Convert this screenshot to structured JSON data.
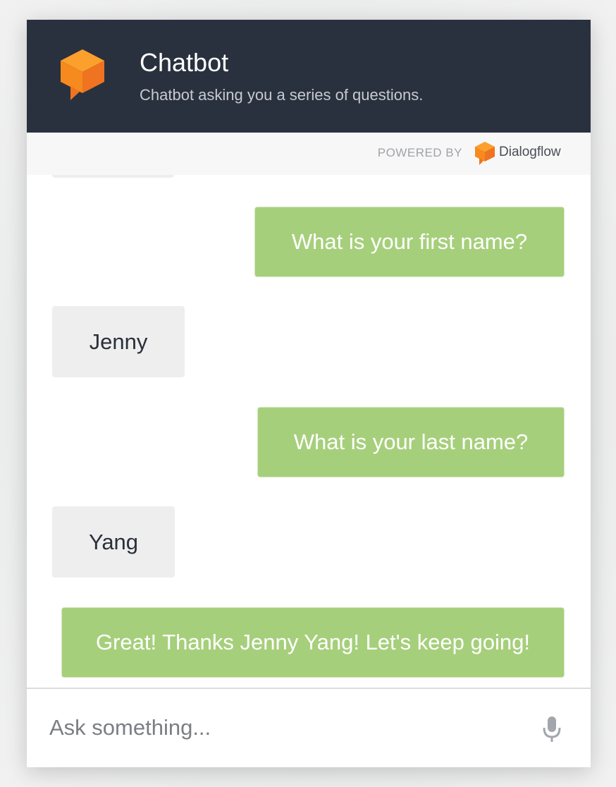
{
  "header": {
    "title": "Chatbot",
    "subtitle": "Chatbot asking you a series of questions."
  },
  "powered_by": {
    "label": "POWERED BY",
    "brand": "Dialogflow"
  },
  "messages": [
    {
      "sender": "user",
      "text": ""
    },
    {
      "sender": "bot",
      "text": "What is your first name?"
    },
    {
      "sender": "user",
      "text": "Jenny"
    },
    {
      "sender": "bot",
      "text": "What is your last name?"
    },
    {
      "sender": "user",
      "text": "Yang"
    },
    {
      "sender": "bot",
      "text": "Great! Thanks Jenny Yang! Let's keep going!"
    }
  ],
  "input": {
    "placeholder": "Ask something...",
    "value": ""
  },
  "icons": {
    "logo": "chatbot-logo-icon",
    "brand_logo": "dialogflow-logo-icon",
    "mic": "microphone-icon"
  },
  "colors": {
    "header_bg": "#2a313e",
    "accent_orange": "#f48c20",
    "bot_bubble": "#a6cf7b",
    "user_bubble": "#eeeeee"
  }
}
